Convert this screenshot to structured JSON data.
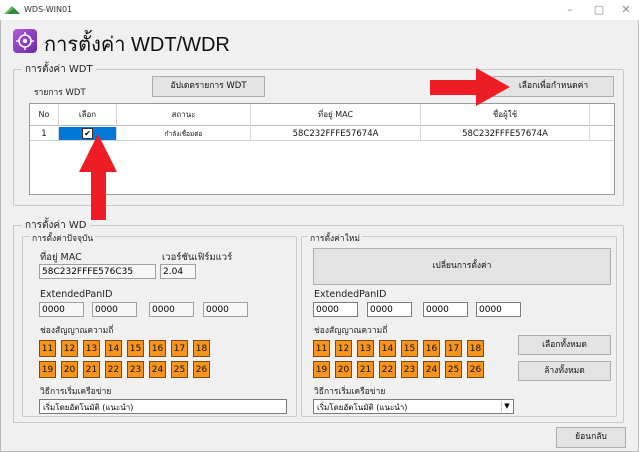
{
  "window": {
    "title": "WDS-WIN01",
    "controls": [
      "–",
      "▢",
      "✕"
    ]
  },
  "header": {
    "title": "การตั้งค่า WDT/WDR"
  },
  "wdt": {
    "legend": "การตั้งค่า WDT",
    "list_label": "รายการ WDT",
    "update_button": "อัปเดตรายการ WDT",
    "select_config_button": "เลือกเพื่อกำหนดค่า",
    "columns": [
      "No",
      "เลือก",
      "สถานะ",
      "ที่อยู่ MAC",
      "ชื่อผู้ใช้"
    ],
    "rows": [
      {
        "no": "1",
        "selected": "✔",
        "status": "กำลังเชื่อมต่อ",
        "mac": "58C232FFFE57674A",
        "name": "58C232FFFE57674A"
      }
    ]
  },
  "wdr": {
    "legend": "การตั้งค่า WD",
    "current": {
      "legend": "การตั้งค่าปัจจุบัน",
      "mac_label": "ที่อยู่ MAC",
      "mac_value": "58C232FFFE576C35",
      "fw_label": "เวอร์ชันเฟิร์มแวร์",
      "fw_value": "2.04",
      "panid_label": "ExtendedPanID",
      "panid_values": [
        "0000",
        "0000",
        "0000",
        "0000"
      ],
      "channel_label": "ช่องสัญญาณความถี่",
      "channels": [
        "11",
        "12",
        "13",
        "14",
        "15",
        "16",
        "17",
        "18",
        "19",
        "20",
        "21",
        "22",
        "23",
        "24",
        "25",
        "26"
      ],
      "method_label": "วิธีการเริ่มเครือข่าย",
      "method_value": "เริ่มโดยอัตโนมัติ (แนะนำ)"
    },
    "new": {
      "legend": "การตั้งค่าใหม่",
      "change_button": "เปลี่ยนการตั้งค่า",
      "panid_label": "ExtendedPanID",
      "panid_values": [
        "0000",
        "0000",
        "0000",
        "0000"
      ],
      "channel_label": "ช่องสัญญาณความถี่",
      "channels": [
        "11",
        "12",
        "13",
        "14",
        "15",
        "16",
        "17",
        "18",
        "19",
        "20",
        "21",
        "22",
        "23",
        "24",
        "25",
        "26"
      ],
      "select_all_button": "เลือกทั้งหมด",
      "clear_all_button": "ล้างทั้งหมด",
      "method_label": "วิธีการเริ่มเครือข่าย",
      "method_value": "เริ่มโดยอัตโนมัติ (แนะนำ)"
    }
  },
  "footer": {
    "back_button": "ย้อนกลับ"
  },
  "colors": {
    "channel_fill": "#f7941d",
    "arrow": "#ee1c24",
    "selected_cell": "#0078d7"
  }
}
